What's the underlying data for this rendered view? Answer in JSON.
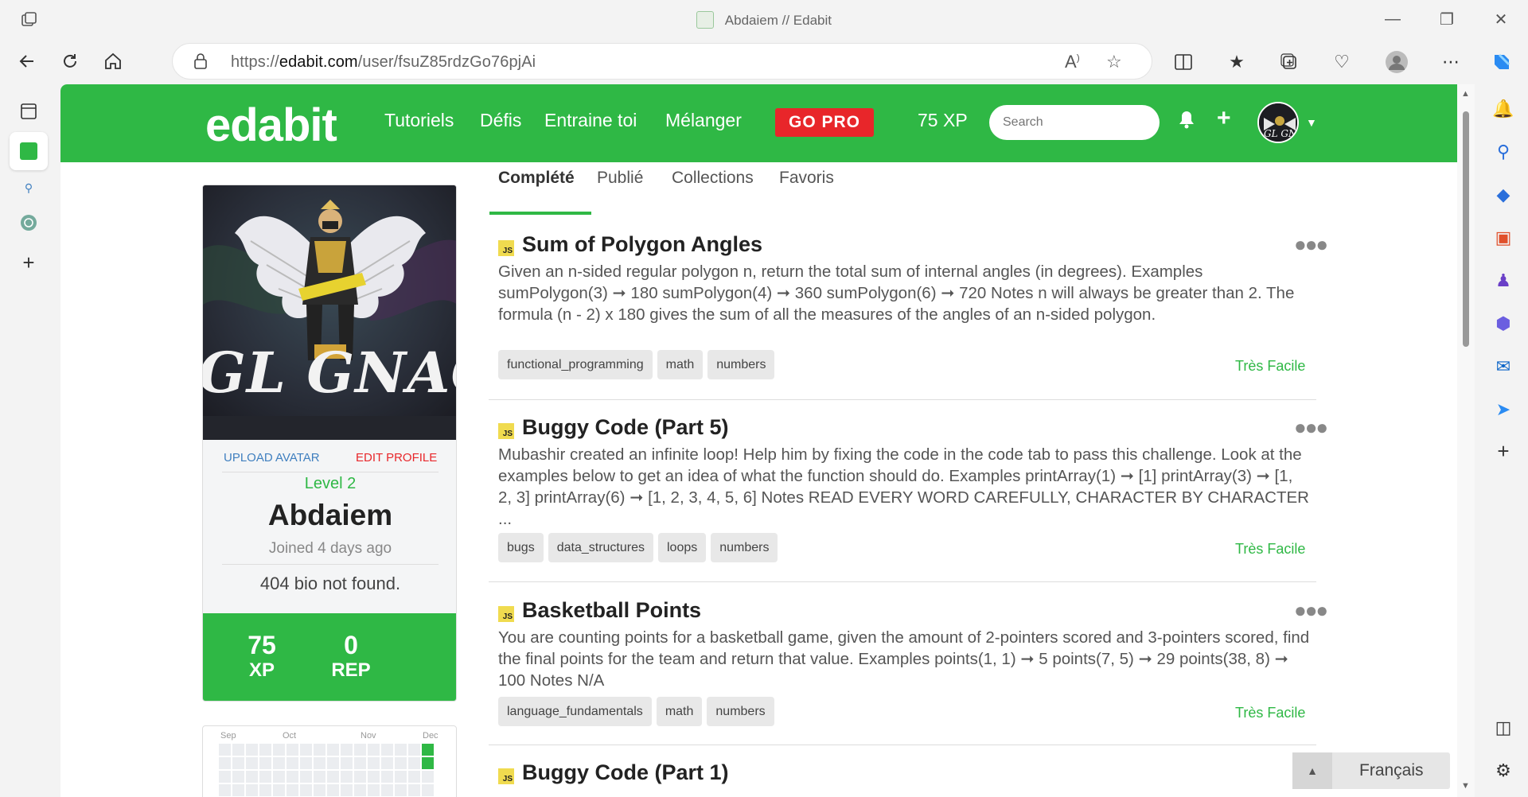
{
  "browser": {
    "window_title": "Abdaiem // Edabit",
    "url_prefix": "https://",
    "url_host": "edabit.com",
    "url_path": "/user/fsuZ85rdzGo76pjAi"
  },
  "header": {
    "logo": "edabit",
    "nav": [
      "Tutoriels",
      "Défis",
      "Entraine toi",
      "Mélanger"
    ],
    "go_pro": "GO PRO",
    "xp": "75 XP",
    "search_placeholder": "Search"
  },
  "profile": {
    "avatar_text": "GL GNACH",
    "upload_avatar": "UPLOAD AVATAR",
    "edit_profile": "EDIT PROFILE",
    "level": "Level 2",
    "name": "Abdaiem",
    "joined": "Joined 4 days ago",
    "bio": "404 bio not found.",
    "stats": [
      {
        "value": "75",
        "label": "XP"
      },
      {
        "value": "0",
        "label": "REP"
      }
    ],
    "calendar_months": [
      "Sep",
      "Oct",
      "Nov",
      "Dec"
    ]
  },
  "tabs": [
    "Complété",
    "Publié",
    "Collections",
    "Favoris"
  ],
  "challenges": [
    {
      "lang": "JS",
      "title": "Sum of Polygon Angles",
      "description": "Given an n-sided regular polygon n, return the total sum of internal angles (in degrees). Examples sumPolygon(3) ➞ 180 sumPolygon(4) ➞ 360 sumPolygon(6) ➞ 720 Notes n will always be greater than 2. The formula (n - 2) x 180 gives the sum of all the measures of the angles of an n-sided polygon.",
      "tags": [
        "functional_programming",
        "math",
        "numbers"
      ],
      "difficulty": "Très Facile"
    },
    {
      "lang": "JS",
      "title": "Buggy Code (Part 5)",
      "description": "Mubashir created an infinite loop! Help him by fixing the code in the code tab to pass this challenge. Look at the examples below to get an idea of what the function should do. Examples printArray(1) ➞ [1] printArray(3) ➞ [1, 2, 3] printArray(6) ➞ [1, 2, 3, 4, 5, 6] Notes READ EVERY WORD CAREFULLY, CHARACTER BY CHARACTER ...",
      "tags": [
        "bugs",
        "data_structures",
        "loops",
        "numbers"
      ],
      "difficulty": "Très Facile"
    },
    {
      "lang": "JS",
      "title": "Basketball Points",
      "description": "You are counting points for a basketball game, given the amount of 2-pointers scored and 3-pointers scored, find the final points for the team and return that value. Examples points(1, 1) ➞ 5 points(7, 5) ➞ 29 points(38, 8) ➞ 100 Notes N/A",
      "tags": [
        "language_fundamentals",
        "math",
        "numbers"
      ],
      "difficulty": "Très Facile"
    },
    {
      "lang": "JS",
      "title": "Buggy Code (Part 1)",
      "description": "",
      "tags": [],
      "difficulty": ""
    }
  ],
  "language_widget": "Français",
  "colors": {
    "brand_green": "#2fb845",
    "pro_red": "#e8262a",
    "js_yellow": "#f0db4f"
  }
}
